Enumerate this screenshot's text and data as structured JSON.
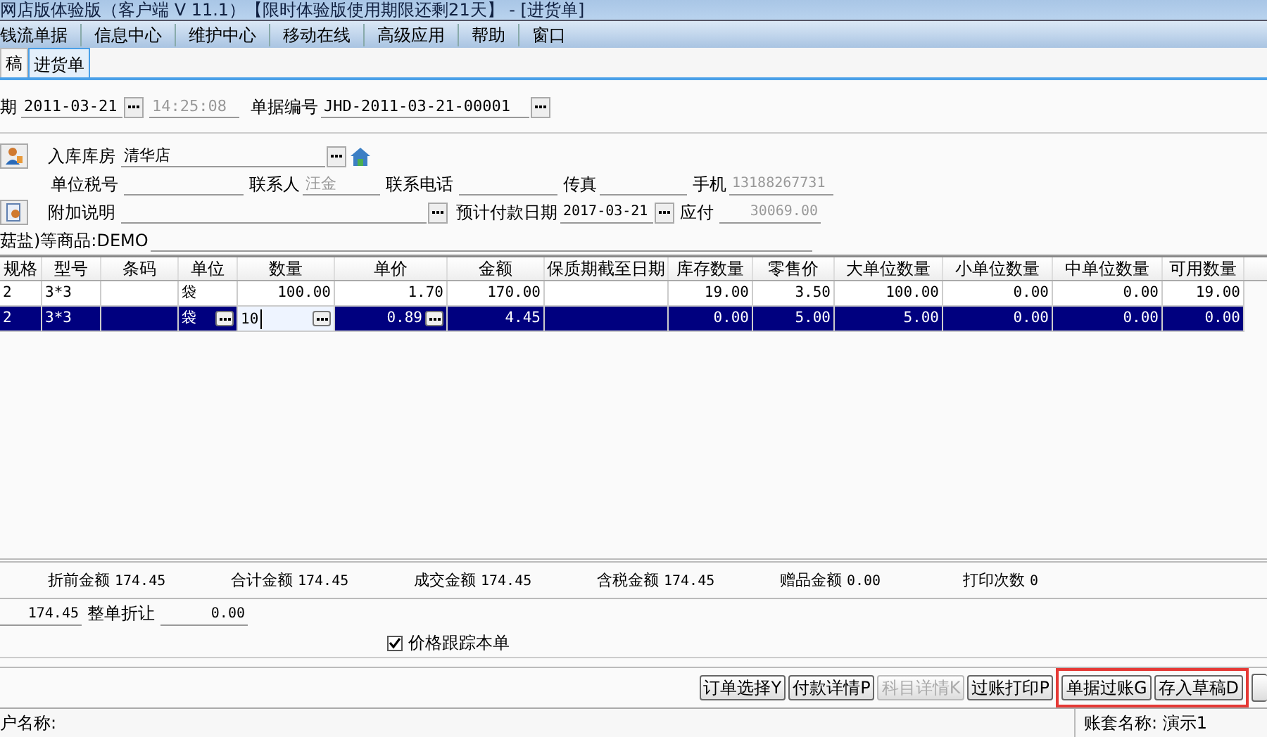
{
  "window": {
    "title": "网店版体验版（客户端 V 11.1）【限时体验版使用期限还剩21天】 - [进货单]"
  },
  "menu": [
    "钱流单据",
    "信息中心",
    "维护中心",
    "移动在线",
    "高级应用",
    "帮助",
    "窗口"
  ],
  "tabs": [
    {
      "label": "稿",
      "selected": false
    },
    {
      "label": "进货单",
      "selected": true
    }
  ],
  "form": {
    "date": {
      "label": "期",
      "value": "2011-03-21",
      "time": "14:25:08"
    },
    "number": {
      "label": "单据编号",
      "value": "JHD-2011-03-21-00001"
    },
    "warehouse": {
      "label": "入库库房",
      "value": "清华店"
    },
    "tax_id": {
      "label": "单位税号"
    },
    "contact": {
      "label": "联系人",
      "value": "汪金"
    },
    "phone": {
      "label": "联系电话"
    },
    "fax": {
      "label": "传真"
    },
    "mobile": {
      "label": "手机",
      "value": "13188267731"
    },
    "note": {
      "label": "附加说明"
    },
    "pay_date": {
      "label": "预计付款日期",
      "value": "2017-03-21"
    },
    "payable": {
      "label": "应付",
      "value": "30069.00"
    },
    "summary_text": "菇盐)等商品:DEMO"
  },
  "table": {
    "columns": [
      "规格",
      "型号",
      "条码",
      "单位",
      "数量",
      "单价",
      "金额",
      "保质期截至日期",
      "库存数量",
      "零售价",
      "大单位数量",
      "小单位数量",
      "中单位数量",
      "可用数量"
    ],
    "rows": [
      {
        "selected": false,
        "cells": [
          {
            "text": "2"
          },
          {
            "text": "3*3"
          },
          {
            "text": ""
          },
          {
            "text": "袋"
          },
          {
            "text": "100.00"
          },
          {
            "text": "1.70"
          },
          {
            "text": "170.00"
          },
          {
            "text": ""
          },
          {
            "text": "19.00"
          },
          {
            "text": "3.50"
          },
          {
            "text": "100.00"
          },
          {
            "text": "0.00"
          },
          {
            "text": "0.00"
          },
          {
            "text": "19.00"
          }
        ]
      },
      {
        "selected": true,
        "cells": [
          {
            "text": "2"
          },
          {
            "text": "3*3"
          },
          {
            "text": ""
          },
          {
            "text": "袋",
            "kind": "picker"
          },
          {
            "text": "10",
            "kind": "editor"
          },
          {
            "text": "0.89",
            "kind": "picker"
          },
          {
            "text": "4.45"
          },
          {
            "text": ""
          },
          {
            "text": "0.00"
          },
          {
            "text": "5.00"
          },
          {
            "text": "5.00"
          },
          {
            "text": "0.00"
          },
          {
            "text": "0.00"
          },
          {
            "text": "0.00"
          }
        ]
      }
    ]
  },
  "totals": [
    {
      "label": "折前金额",
      "value": "174.45"
    },
    {
      "label": "合计金额",
      "value": "174.45"
    },
    {
      "label": "成交金额",
      "value": "174.45"
    },
    {
      "label": "含税金额",
      "value": "174.45"
    },
    {
      "label": "赠品金额",
      "value": "0.00"
    },
    {
      "label": "打印次数",
      "value": "0"
    }
  ],
  "discount": {
    "amount": "174.45",
    "label": "整单折让",
    "value": "0.00"
  },
  "price_tracking": {
    "label": "价格跟踪本单",
    "checked": true
  },
  "buttons": [
    {
      "label": "订单选择Y",
      "disabled": false,
      "highlighted": false
    },
    {
      "label": "付款详情P",
      "disabled": false,
      "highlighted": false
    },
    {
      "label": "科目详情K",
      "disabled": true,
      "highlighted": false
    },
    {
      "label": "过账打印P",
      "disabled": false,
      "highlighted": false
    },
    {
      "label": "单据过账G",
      "disabled": false,
      "highlighted": true
    },
    {
      "label": "存入草稿D",
      "disabled": false,
      "highlighted": true
    }
  ],
  "status_bar": {
    "user": "户名称:",
    "account": "账套名称: 演示1"
  }
}
